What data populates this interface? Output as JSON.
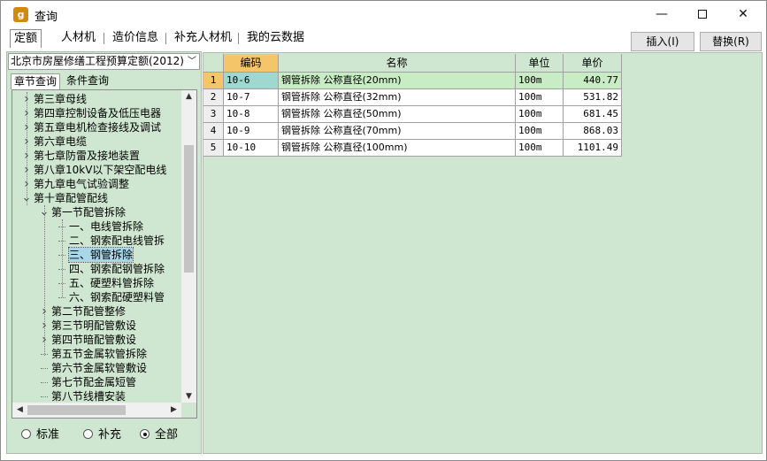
{
  "window": {
    "title": "查询",
    "icon": "app-logo-icon",
    "minimize": "—",
    "close": "✕"
  },
  "tabs": [
    {
      "label": "定额",
      "active": true
    },
    {
      "label": "人材机"
    },
    {
      "label": "造价信息"
    },
    {
      "label": "补充人材机"
    },
    {
      "label": "我的云数据"
    }
  ],
  "buttons": {
    "insert": "插入(I)",
    "replace": "替换(R)"
  },
  "left": {
    "select_value": "北京市房屋修缮工程预算定额(2012)",
    "subtabs": [
      "章节查询",
      "条件查询"
    ],
    "tree": [
      {
        "label": "第三章母线",
        "level": 1,
        "toggle": "collapsed"
      },
      {
        "label": "第四章控制设备及低压电器",
        "level": 1,
        "toggle": "collapsed"
      },
      {
        "label": "第五章电机检查接线及调试",
        "level": 1,
        "toggle": "collapsed"
      },
      {
        "label": "第六章电缆",
        "level": 1,
        "toggle": "collapsed"
      },
      {
        "label": "第七章防雷及接地装置",
        "level": 1,
        "toggle": "collapsed"
      },
      {
        "label": "第八章10kV以下架空配电线",
        "level": 1,
        "toggle": "collapsed"
      },
      {
        "label": "第九章电气试验调整",
        "level": 1,
        "toggle": "collapsed"
      },
      {
        "label": "第十章配管配线",
        "level": 1,
        "toggle": "expanded"
      },
      {
        "label": "第一节配管拆除",
        "level": 2,
        "toggle": "expanded"
      },
      {
        "label": "一、电线管拆除",
        "level": 3,
        "toggle": "leaf"
      },
      {
        "label": "二、钢索配电线管拆",
        "level": 3,
        "toggle": "leaf"
      },
      {
        "label": "三、钢管拆除",
        "level": 3,
        "toggle": "leaf",
        "selected": true
      },
      {
        "label": "四、钢索配钢管拆除",
        "level": 3,
        "toggle": "leaf"
      },
      {
        "label": "五、硬塑料管拆除",
        "level": 3,
        "toggle": "leaf"
      },
      {
        "label": "六、钢索配硬塑料管",
        "level": 3,
        "toggle": "leaf"
      },
      {
        "label": "第二节配管整修",
        "level": 2,
        "toggle": "collapsed"
      },
      {
        "label": "第三节明配管敷设",
        "level": 2,
        "toggle": "collapsed"
      },
      {
        "label": "第四节暗配管敷设",
        "level": 2,
        "toggle": "collapsed"
      },
      {
        "label": "第五节金属软管拆除",
        "level": 2,
        "toggle": "leaf"
      },
      {
        "label": "第六节金属软管敷设",
        "level": 2,
        "toggle": "leaf"
      },
      {
        "label": "第七节配金属短管",
        "level": 2,
        "toggle": "leaf"
      },
      {
        "label": "第八节线槽安装",
        "level": 2,
        "toggle": "leaf"
      }
    ],
    "radios": [
      {
        "label": "标准",
        "checked": false
      },
      {
        "label": "补充",
        "checked": false
      },
      {
        "label": "全部",
        "checked": true
      }
    ]
  },
  "table": {
    "headers": {
      "code": "编码",
      "name": "名称",
      "unit": "单位",
      "price": "单价"
    },
    "rows": [
      {
        "n": "1",
        "code": "10-6",
        "name": "钢管拆除 公称直径(20mm)",
        "unit": "100m",
        "price": "440.77",
        "selected": true
      },
      {
        "n": "2",
        "code": "10-7",
        "name": "钢管拆除 公称直径(32mm)",
        "unit": "100m",
        "price": "531.82"
      },
      {
        "n": "3",
        "code": "10-8",
        "name": "钢管拆除 公称直径(50mm)",
        "unit": "100m",
        "price": "681.45"
      },
      {
        "n": "4",
        "code": "10-9",
        "name": "钢管拆除 公称直径(70mm)",
        "unit": "100m",
        "price": "868.03"
      },
      {
        "n": "5",
        "code": "10-10",
        "name": "钢管拆除 公称直径(100mm)",
        "unit": "100m",
        "price": "1101.49"
      }
    ]
  }
}
